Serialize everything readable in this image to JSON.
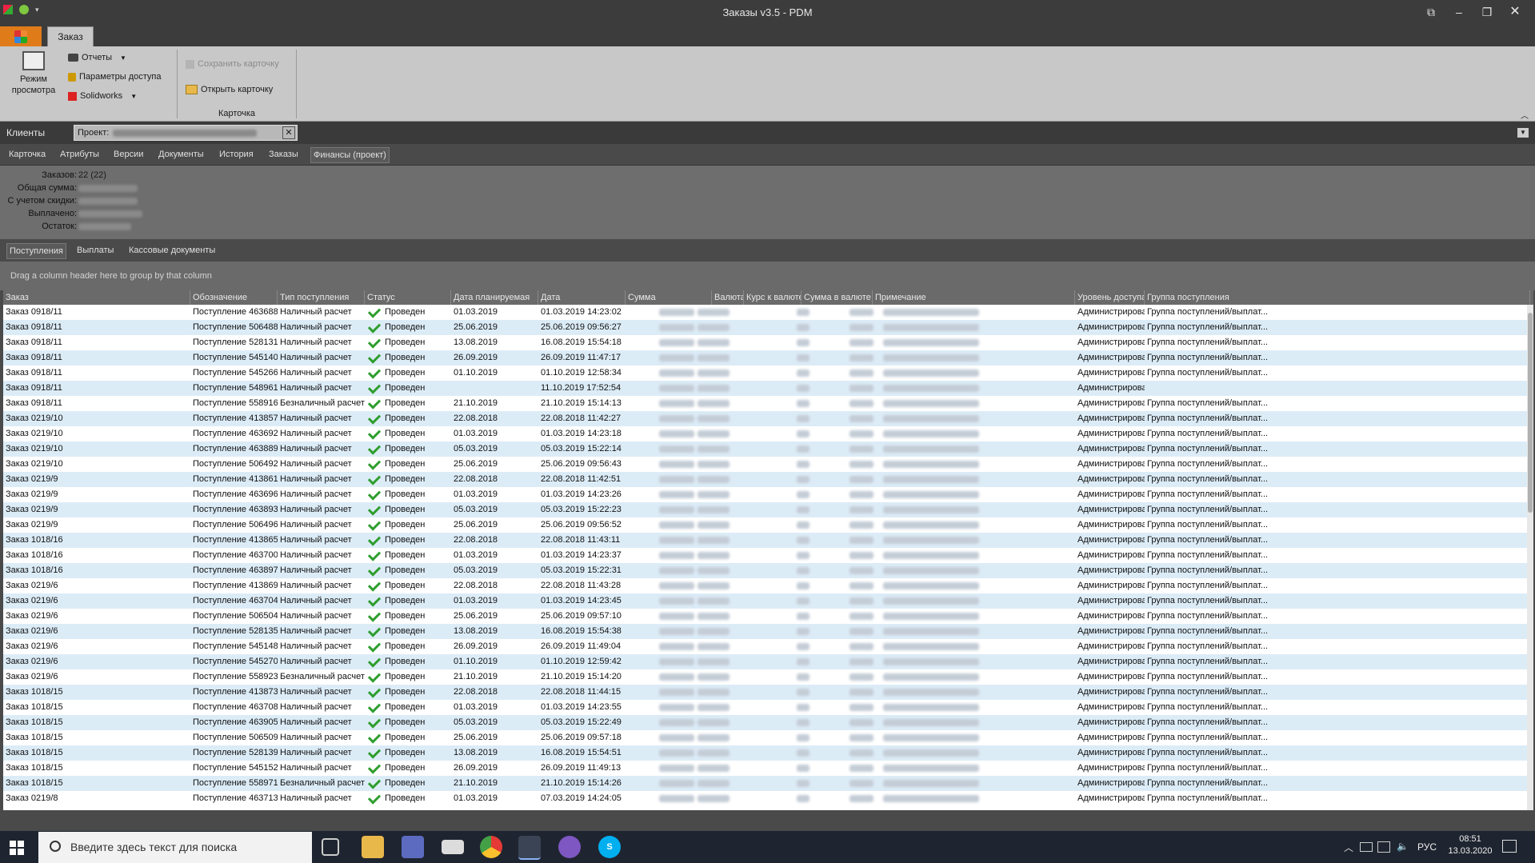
{
  "window": {
    "title": "Заказы v3.5 - PDM"
  },
  "ribbon": {
    "tab": "Заказ",
    "view_mode": "Режим\nпросмотра",
    "reports": "Отчеты",
    "access": "Параметры доступа",
    "solidworks": "Solidworks",
    "save_card": "Сохранить карточку",
    "open_card": "Открыть карточку",
    "group_label": "Карточка"
  },
  "doctabs": {
    "clients": "Клиенты",
    "project": "Проект:"
  },
  "subtabs": [
    "Карточка",
    "Атрибуты",
    "Версии",
    "Документы",
    "История",
    "Заказы",
    "Финансы (проект)"
  ],
  "summary": {
    "orders_label": "Заказов:",
    "orders_value": "22 (22)",
    "total_label": "Общая сумма:",
    "discount_label": "С учетом скидки:",
    "paid_label": "Выплачено:",
    "rest_label": "Остаток:"
  },
  "lowtabs": [
    "Поступления",
    "Выплаты",
    "Кассовые документы"
  ],
  "group_hint": "Drag a column header here to group by that column",
  "columns": [
    "Заказ",
    "Обозначение",
    "Тип поступления",
    "Статус",
    "Дата планируемая",
    "Дата",
    "Сумма",
    "Валюта",
    "Курс к валюте з",
    "Сумма в валюте зак",
    "Примечание",
    "Уровень доступа",
    "Группа поступления"
  ],
  "rows": [
    [
      "Заказ 0918/11",
      "Поступление 463688",
      "Наличный расчет",
      "Проведен",
      "01.03.2019",
      "01.03.2019 14:23:02",
      "Администрирован...",
      "Группа поступлений/выплат..."
    ],
    [
      "Заказ 0918/11",
      "Поступление 506488",
      "Наличный расчет",
      "Проведен",
      "25.06.2019",
      "25.06.2019 09:56:27",
      "Администрирован...",
      "Группа поступлений/выплат..."
    ],
    [
      "Заказ 0918/11",
      "Поступление 528131",
      "Наличный расчет",
      "Проведен",
      "13.08.2019",
      "16.08.2019 15:54:18",
      "Администрирован...",
      "Группа поступлений/выплат..."
    ],
    [
      "Заказ 0918/11",
      "Поступление 545140",
      "Наличный расчет",
      "Проведен",
      "26.09.2019",
      "26.09.2019 11:47:17",
      "Администрирован...",
      "Группа поступлений/выплат..."
    ],
    [
      "Заказ 0918/11",
      "Поступление 545266",
      "Наличный расчет",
      "Проведен",
      "01.10.2019",
      "01.10.2019 12:58:34",
      "Администрирован...",
      "Группа поступлений/выплат..."
    ],
    [
      "Заказ 0918/11",
      "Поступление 548961",
      "Наличный расчет",
      "Проведен",
      "",
      "11.10.2019 17:52:54",
      "Администрирован...",
      ""
    ],
    [
      "Заказ 0918/11",
      "Поступление 558916",
      "Безналичный расчет",
      "Проведен",
      "21.10.2019",
      "21.10.2019 15:14:13",
      "Администрирован...",
      "Группа поступлений/выплат..."
    ],
    [
      "Заказ 0219/10",
      "Поступление 413857",
      "Наличный расчет",
      "Проведен",
      "22.08.2018",
      "22.08.2018 11:42:27",
      "Администрирован...",
      "Группа поступлений/выплат..."
    ],
    [
      "Заказ 0219/10",
      "Поступление 463692",
      "Наличный расчет",
      "Проведен",
      "01.03.2019",
      "01.03.2019 14:23:18",
      "Администрирован...",
      "Группа поступлений/выплат..."
    ],
    [
      "Заказ 0219/10",
      "Поступление 463889",
      "Наличный расчет",
      "Проведен",
      "05.03.2019",
      "05.03.2019 15:22:14",
      "Администрирован...",
      "Группа поступлений/выплат..."
    ],
    [
      "Заказ 0219/10",
      "Поступление 506492",
      "Наличный расчет",
      "Проведен",
      "25.06.2019",
      "25.06.2019 09:56:43",
      "Администрирован...",
      "Группа поступлений/выплат..."
    ],
    [
      "Заказ 0219/9",
      "Поступление 413861",
      "Наличный расчет",
      "Проведен",
      "22.08.2018",
      "22.08.2018 11:42:51",
      "Администрирован...",
      "Группа поступлений/выплат..."
    ],
    [
      "Заказ 0219/9",
      "Поступление 463696",
      "Наличный расчет",
      "Проведен",
      "01.03.2019",
      "01.03.2019 14:23:26",
      "Администрирован...",
      "Группа поступлений/выплат..."
    ],
    [
      "Заказ 0219/9",
      "Поступление 463893",
      "Наличный расчет",
      "Проведен",
      "05.03.2019",
      "05.03.2019 15:22:23",
      "Администрирован...",
      "Группа поступлений/выплат..."
    ],
    [
      "Заказ 0219/9",
      "Поступление 506496",
      "Наличный расчет",
      "Проведен",
      "25.06.2019",
      "25.06.2019 09:56:52",
      "Администрирован...",
      "Группа поступлений/выплат..."
    ],
    [
      "Заказ 1018/16",
      "Поступление 413865",
      "Наличный расчет",
      "Проведен",
      "22.08.2018",
      "22.08.2018 11:43:11",
      "Администрирован...",
      "Группа поступлений/выплат..."
    ],
    [
      "Заказ 1018/16",
      "Поступление 463700",
      "Наличный расчет",
      "Проведен",
      "01.03.2019",
      "01.03.2019 14:23:37",
      "Администрирован...",
      "Группа поступлений/выплат..."
    ],
    [
      "Заказ 1018/16",
      "Поступление 463897",
      "Наличный расчет",
      "Проведен",
      "05.03.2019",
      "05.03.2019 15:22:31",
      "Администрирован...",
      "Группа поступлений/выплат..."
    ],
    [
      "Заказ 0219/6",
      "Поступление 413869",
      "Наличный расчет",
      "Проведен",
      "22.08.2018",
      "22.08.2018 11:43:28",
      "Администрирован...",
      "Группа поступлений/выплат..."
    ],
    [
      "Заказ 0219/6",
      "Поступление 463704",
      "Наличный расчет",
      "Проведен",
      "01.03.2019",
      "01.03.2019 14:23:45",
      "Администрирован...",
      "Группа поступлений/выплат..."
    ],
    [
      "Заказ 0219/6",
      "Поступление 506504",
      "Наличный расчет",
      "Проведен",
      "25.06.2019",
      "25.06.2019 09:57:10",
      "Администрирован...",
      "Группа поступлений/выплат..."
    ],
    [
      "Заказ 0219/6",
      "Поступление 528135",
      "Наличный расчет",
      "Проведен",
      "13.08.2019",
      "16.08.2019 15:54:38",
      "Администрирован...",
      "Группа поступлений/выплат..."
    ],
    [
      "Заказ 0219/6",
      "Поступление 545148",
      "Наличный расчет",
      "Проведен",
      "26.09.2019",
      "26.09.2019 11:49:04",
      "Администрирован...",
      "Группа поступлений/выплат..."
    ],
    [
      "Заказ 0219/6",
      "Поступление 545270",
      "Наличный расчет",
      "Проведен",
      "01.10.2019",
      "01.10.2019 12:59:42",
      "Администрирован...",
      "Группа поступлений/выплат..."
    ],
    [
      "Заказ 0219/6",
      "Поступление 558923",
      "Безналичный расчет",
      "Проведен",
      "21.10.2019",
      "21.10.2019 15:14:20",
      "Администрирован...",
      "Группа поступлений/выплат..."
    ],
    [
      "Заказ 1018/15",
      "Поступление 413873",
      "Наличный расчет",
      "Проведен",
      "22.08.2018",
      "22.08.2018 11:44:15",
      "Администрирован...",
      "Группа поступлений/выплат..."
    ],
    [
      "Заказ 1018/15",
      "Поступление 463708",
      "Наличный расчет",
      "Проведен",
      "01.03.2019",
      "01.03.2019 14:23:55",
      "Администрирован...",
      "Группа поступлений/выплат..."
    ],
    [
      "Заказ 1018/15",
      "Поступление 463905",
      "Наличный расчет",
      "Проведен",
      "05.03.2019",
      "05.03.2019 15:22:49",
      "Администрирован...",
      "Группа поступлений/выплат..."
    ],
    [
      "Заказ 1018/15",
      "Поступление 506509",
      "Наличный расчет",
      "Проведен",
      "25.06.2019",
      "25.06.2019 09:57:18",
      "Администрирован...",
      "Группа поступлений/выплат..."
    ],
    [
      "Заказ 1018/15",
      "Поступление 528139",
      "Наличный расчет",
      "Проведен",
      "13.08.2019",
      "16.08.2019 15:54:51",
      "Администрирован...",
      "Группа поступлений/выплат..."
    ],
    [
      "Заказ 1018/15",
      "Поступление 545152",
      "Наличный расчет",
      "Проведен",
      "26.09.2019",
      "26.09.2019 11:49:13",
      "Администрирован...",
      "Группа поступлений/выплат..."
    ],
    [
      "Заказ 1018/15",
      "Поступление 558971",
      "Безналичный расчет",
      "Проведен",
      "21.10.2019",
      "21.10.2019 15:14:26",
      "Администрирован...",
      "Группа поступлений/выплат..."
    ],
    [
      "Заказ 0219/8",
      "Поступление 463713",
      "Наличный расчет",
      "Проведен",
      "01.03.2019",
      "07.03.2019 14:24:05",
      "Администрирован...",
      "Группа поступлений/выплат..."
    ]
  ],
  "taskbar": {
    "search_placeholder": "Введите здесь текст для поиска",
    "lang": "РУС",
    "time": "08:51",
    "date": "13.03.2020"
  },
  "colors": {
    "accent": "#e07b1a",
    "row_alt": "#dcecf7",
    "row": "#ffffff"
  }
}
